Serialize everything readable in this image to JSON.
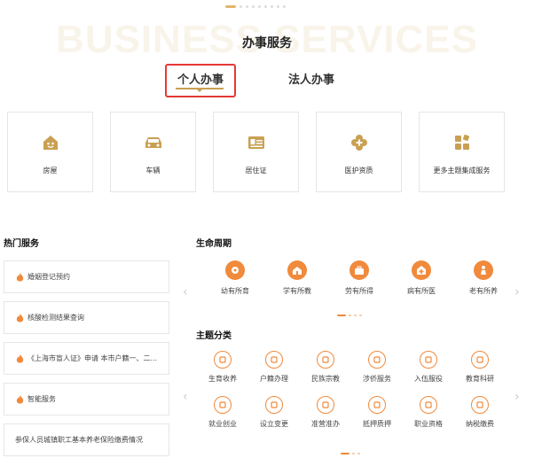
{
  "header": {
    "background_title": "BUSINESS SERVICES",
    "title": "办事服务"
  },
  "tabs": [
    {
      "label": "个人办事",
      "active": true
    },
    {
      "label": "法人办事",
      "active": false
    }
  ],
  "service_cards": [
    {
      "label": "房屋",
      "icon": "house-icon"
    },
    {
      "label": "车辆",
      "icon": "car-icon"
    },
    {
      "label": "居住证",
      "icon": "id-card-icon"
    },
    {
      "label": "医护资质",
      "icon": "medical-cross-icon"
    },
    {
      "label": "更多主题集成服务",
      "icon": "grid-icon"
    }
  ],
  "hot_services": {
    "title": "热门服务",
    "items": [
      {
        "label": "婚姻登记预约"
      },
      {
        "label": "核酸检测结果查询"
      },
      {
        "label": "《上海市盲人证》申请 本市户籍一、二..."
      },
      {
        "label": "智能服务"
      },
      {
        "label": "参保人员城镇职工基本养老保险缴费情况"
      }
    ]
  },
  "life_cycle": {
    "title": "生命周期",
    "items": [
      {
        "label": "幼有所育",
        "icon": "baby-icon"
      },
      {
        "label": "学有所教",
        "icon": "school-icon"
      },
      {
        "label": "劳有所得",
        "icon": "briefcase-icon"
      },
      {
        "label": "病有所医",
        "icon": "hospital-icon"
      },
      {
        "label": "老有所养",
        "icon": "elderly-icon"
      }
    ]
  },
  "topics": {
    "title": "主题分类",
    "items": [
      {
        "label": "生育收养",
        "icon": "baby-face-icon"
      },
      {
        "label": "户籍办理",
        "icon": "household-register-icon"
      },
      {
        "label": "民族宗教",
        "icon": "temple-icon"
      },
      {
        "label": "涉侨服务",
        "icon": "document-icon"
      },
      {
        "label": "入伍服役",
        "icon": "military-icon"
      },
      {
        "label": "教育科研",
        "icon": "graduation-cap-icon"
      },
      {
        "label": "就业创业",
        "icon": "lightbulb-icon"
      },
      {
        "label": "设立变更",
        "icon": "registration-icon"
      },
      {
        "label": "准营准办",
        "icon": "shop-icon"
      },
      {
        "label": "抵押质押",
        "icon": "mortgage-icon"
      },
      {
        "label": "职业资格",
        "icon": "certificate-icon"
      },
      {
        "label": "纳税缴费",
        "icon": "tax-icon"
      }
    ]
  },
  "colors": {
    "gold_accent": "#c9a053",
    "orange_accent": "#f08a3c",
    "highlight_box": "#e53935"
  }
}
